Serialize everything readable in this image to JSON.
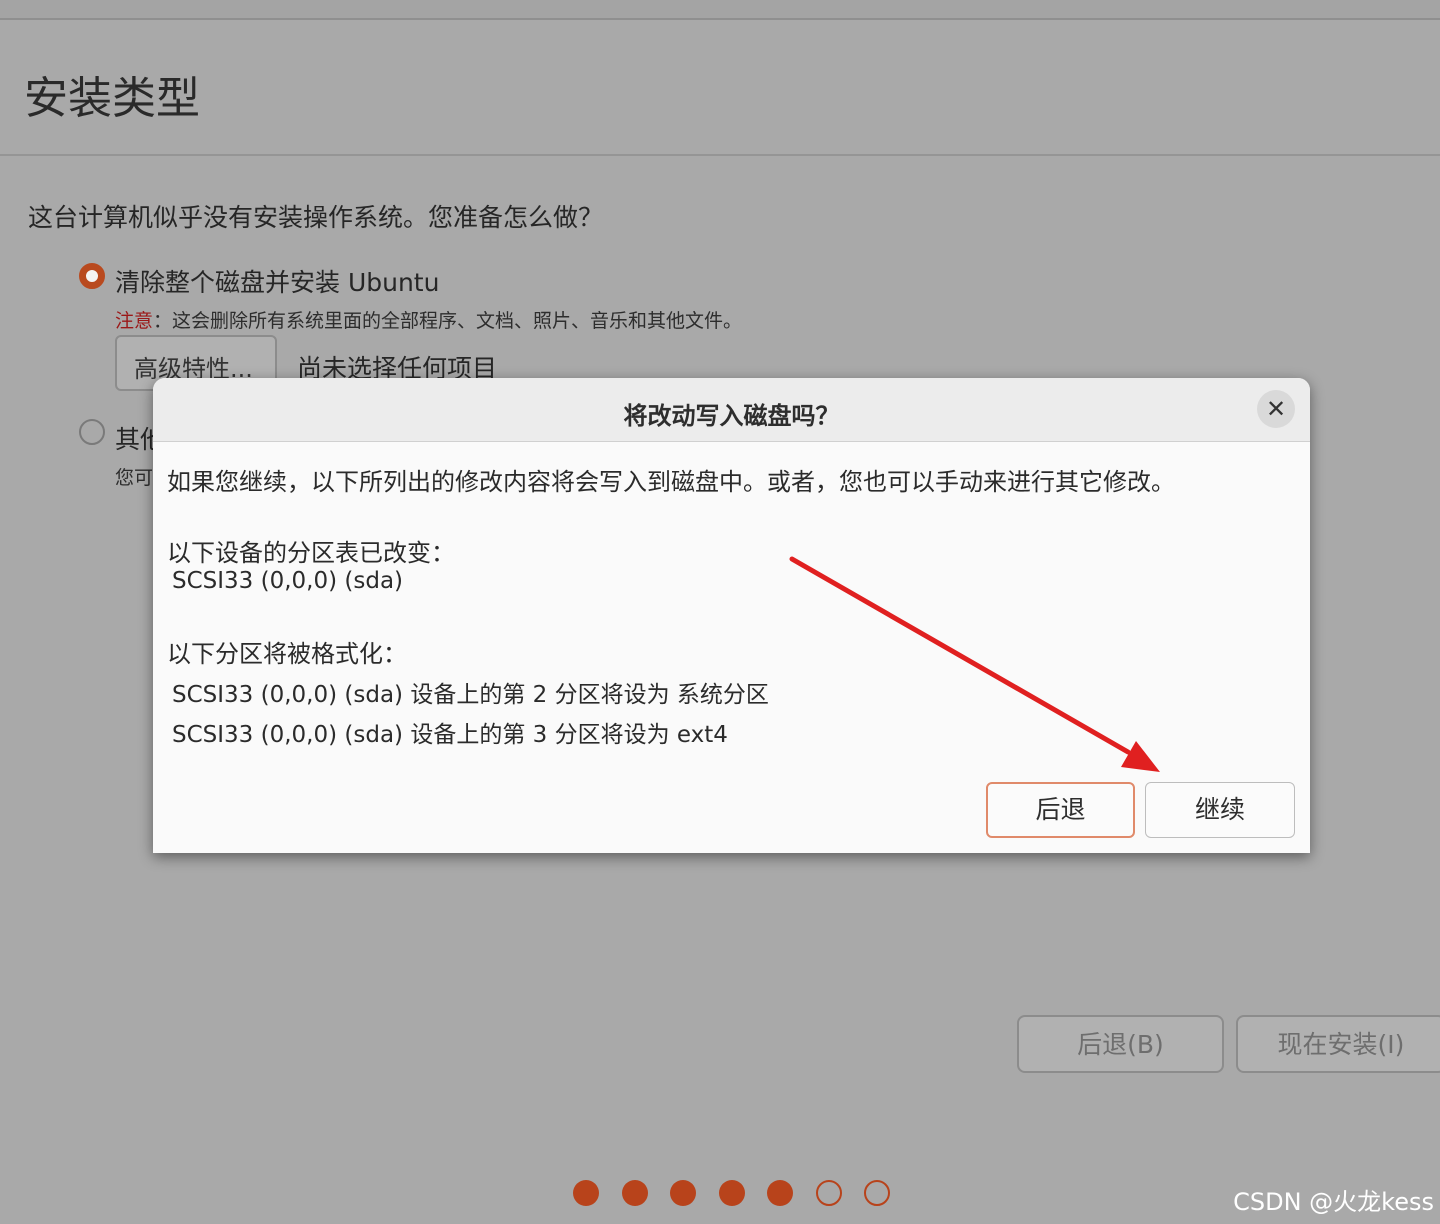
{
  "page": {
    "title": "安装类型",
    "question": "这台计算机似乎没有安装操作系统。您准备怎么做？",
    "option_erase": {
      "label": "清除整个磁盘并安装 Ubuntu",
      "warning_prefix": "注意",
      "warning_text": "：这会删除所有系统里面的全部程序、文档、照片、音乐和其他文件。",
      "advanced_button": "高级特性...",
      "advanced_status": "尚未选择任何项目"
    },
    "option_other": {
      "label": "其他",
      "desc": "您可"
    },
    "back_button": "后退(B)",
    "install_button": "现在安装(I)",
    "progress": {
      "total": 7,
      "completed": 5
    }
  },
  "dialog": {
    "title": "将改动写入磁盘吗？",
    "close_symbol": "✕",
    "intro": "如果您继续，以下所列出的修改内容将会写入到磁盘中。或者，您也可以手动来进行其它修改。",
    "partition_table_heading": "以下设备的分区表已改变：",
    "partition_table_device": "SCSI33 (0,0,0) (sda)",
    "format_heading": "以下分区将被格式化：",
    "format_items": [
      "SCSI33 (0,0,0) (sda) 设备上的第 2 分区将设为 系统分区",
      "SCSI33 (0,0,0) (sda) 设备上的第 3 分区将设为 ext4"
    ],
    "back_button": "后退",
    "continue_button": "继续"
  },
  "watermark": "CSDN @火龙kess",
  "colors": {
    "accent": "#b8431b",
    "warning": "#9b1818",
    "annotation_arrow": "#e02020"
  }
}
